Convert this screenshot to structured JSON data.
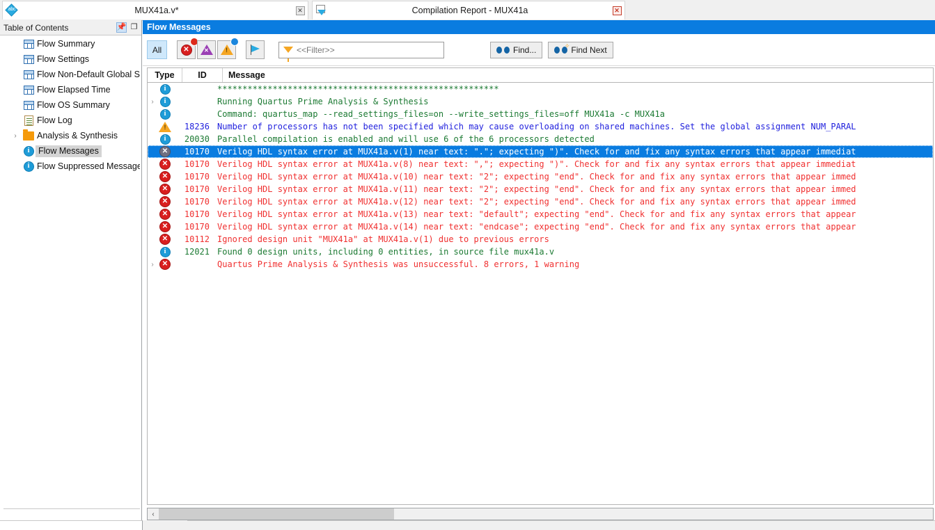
{
  "tabs": [
    {
      "title": "MUX41a.v*",
      "icon": "abc-diamond-icon",
      "close": "✕",
      "active": false
    },
    {
      "title": "Compilation Report - MUX41a",
      "icon": "report-page-icon",
      "close": "✕",
      "active": true
    }
  ],
  "toc": {
    "header_title": "Table of Contents",
    "pin_glyph": "୧",
    "float_glyph": "❐",
    "items": [
      {
        "label": "Flow Summary",
        "icon": "table-icon",
        "arrow": "",
        "selected": false
      },
      {
        "label": "Flow Settings",
        "icon": "table-icon",
        "arrow": "",
        "selected": false
      },
      {
        "label": "Flow Non-Default Global Sett",
        "icon": "table-icon",
        "arrow": "",
        "selected": false
      },
      {
        "label": "Flow Elapsed Time",
        "icon": "table-icon",
        "arrow": "",
        "selected": false
      },
      {
        "label": "Flow OS Summary",
        "icon": "table-icon",
        "arrow": "",
        "selected": false
      },
      {
        "label": "Flow Log",
        "icon": "doc-icon",
        "arrow": "",
        "selected": false
      },
      {
        "label": "Analysis & Synthesis",
        "icon": "folder-icon",
        "arrow": "›",
        "selected": false
      },
      {
        "label": "Flow Messages",
        "icon": "info-icon",
        "arrow": "",
        "selected": true
      },
      {
        "label": "Flow Suppressed Messages",
        "icon": "info-icon",
        "arrow": "",
        "selected": false
      }
    ]
  },
  "panel": {
    "title": "Flow Messages"
  },
  "toolbar": {
    "all_label": "All",
    "buttons": [
      {
        "name": "error-filter-button",
        "icon": "error-icon",
        "badge": "red"
      },
      {
        "name": "critical-warning-filter-button",
        "icon": "critical-warning-icon",
        "badge": "none"
      },
      {
        "name": "warning-filter-button",
        "icon": "warning-icon",
        "badge": "blue"
      },
      {
        "name": "info-flag-filter-button",
        "icon": "flag-icon",
        "badge": "none"
      }
    ],
    "filter_placeholder": "<<Filter>>",
    "filter_value": "",
    "find_label": "Find...",
    "find_next_label": "Find Next"
  },
  "table": {
    "columns": [
      "Type",
      "ID",
      "Message"
    ],
    "rows": [
      {
        "arrow": "",
        "type": "info",
        "id": "",
        "msg": "********************************************************",
        "color": "green"
      },
      {
        "arrow": "›",
        "type": "info",
        "id": "",
        "msg": "Running Quartus Prime Analysis & Synthesis",
        "color": "green"
      },
      {
        "arrow": "",
        "type": "info",
        "id": "",
        "msg": "Command: quartus_map --read_settings_files=on --write_settings_files=off MUX41a -c MUX41a",
        "color": "green"
      },
      {
        "arrow": "",
        "type": "warning",
        "id": "18236",
        "msg": "Number of processors has not been specified which may cause overloading on shared machines.  Set the global assignment NUM_PARAL",
        "color": "blue"
      },
      {
        "arrow": "",
        "type": "info",
        "id": "20030",
        "msg": "Parallel compilation is enabled and will use 6 of the 6 processors detected",
        "color": "green"
      },
      {
        "arrow": "",
        "type": "error",
        "id": "10170",
        "msg": "Verilog HDL syntax error at MUX41a.v(1) near text:  \".\";  expecting \")\". Check for and fix any syntax errors that appear immediat",
        "color": "white",
        "selected": true
      },
      {
        "arrow": "",
        "type": "error",
        "id": "10170",
        "msg": "Verilog HDL syntax error at MUX41a.v(8) near text: \",\";  expecting \")\". Check for and fix any syntax errors that appear immediat",
        "color": "red"
      },
      {
        "arrow": "",
        "type": "error",
        "id": "10170",
        "msg": "Verilog HDL syntax error at MUX41a.v(10) near text: \"2\";  expecting \"end\". Check for and fix any syntax errors that appear immed",
        "color": "red"
      },
      {
        "arrow": "",
        "type": "error",
        "id": "10170",
        "msg": "Verilog HDL syntax error at MUX41a.v(11) near text: \"2\";  expecting \"end\". Check for and fix any syntax errors that appear immed",
        "color": "red"
      },
      {
        "arrow": "",
        "type": "error",
        "id": "10170",
        "msg": "Verilog HDL syntax error at MUX41a.v(12) near text: \"2\";  expecting \"end\". Check for and fix any syntax errors that appear immed",
        "color": "red"
      },
      {
        "arrow": "",
        "type": "error",
        "id": "10170",
        "msg": "Verilog HDL syntax error at MUX41a.v(13) near text: \"default\";  expecting \"end\". Check for and fix any syntax errors that appear",
        "color": "red"
      },
      {
        "arrow": "",
        "type": "error",
        "id": "10170",
        "msg": "Verilog HDL syntax error at MUX41a.v(14) near text: \"endcase\";  expecting \"end\". Check for and fix any syntax errors that appear",
        "color": "red"
      },
      {
        "arrow": "",
        "type": "error",
        "id": "10112",
        "msg": "Ignored design unit \"MUX41a\" at MUX41a.v(1) due to previous errors",
        "color": "red"
      },
      {
        "arrow": "",
        "type": "info",
        "id": "12021",
        "msg": "Found 0 design units, including 0 entities, in source file mux41a.v",
        "color": "green"
      },
      {
        "arrow": "›",
        "type": "error",
        "id": "",
        "msg": "Quartus Prime Analysis & Synthesis was unsuccessful. 8 errors, 1 warning",
        "color": "red"
      }
    ]
  },
  "scrollbar": {
    "left_arrow": "‹"
  },
  "colors": {
    "accent_blue": "#0a7ce0",
    "error_red": "#d91f1f",
    "warning_orange": "#f5a623",
    "critical_purple": "#9b3fb5",
    "info_blue": "#1f9cd8",
    "text_green": "#1c7a33",
    "text_blue": "#1f1fdd",
    "text_red": "#f03030"
  }
}
